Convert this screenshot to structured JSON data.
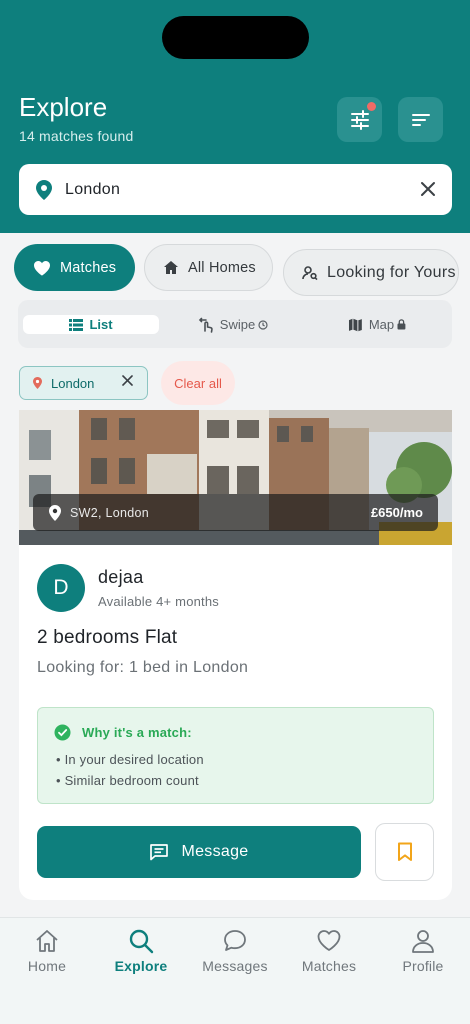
{
  "header": {
    "title": "Explore",
    "subtitle": "14 matches found",
    "filter_icon": "sliders-icon",
    "sort_icon": "sort-lines-icon",
    "accent": "#0e7f7d",
    "notification_dot": "#f06b66"
  },
  "search": {
    "value": "London",
    "icon": "location-pin-icon",
    "clear_icon": "close-icon"
  },
  "tabs": [
    {
      "label": "Matches",
      "icon": "heart-icon",
      "active": true
    },
    {
      "label": "All Homes",
      "icon": "home-icon",
      "active": false
    },
    {
      "label": "Looking for Yours",
      "icon": "person-search-icon",
      "active": false
    }
  ],
  "view_toggle": {
    "list": "List",
    "swipe": "Swipe",
    "map": "Map",
    "selected": "List"
  },
  "filters": {
    "chip_label": "London",
    "clear_all": "Clear all"
  },
  "listing": {
    "location": "SW2, London",
    "price": "£650/mo",
    "avatar_letter": "D",
    "user_name": "dejaa",
    "availability": "Available 4+ months",
    "title": "2 bedrooms Flat",
    "looking_for": "Looking for: 1 bed in London",
    "why_title": "Why it's a match:",
    "reasons": [
      "• In your desired location",
      "• Similar bedroom count"
    ],
    "message_label": "Message",
    "bookmark_color": "#f2a51a"
  },
  "bottom_nav": [
    {
      "label": "Home",
      "icon": "home-icon",
      "active": false
    },
    {
      "label": "Explore",
      "icon": "search-icon",
      "active": true
    },
    {
      "label": "Messages",
      "icon": "chat-bubble-icon",
      "active": false
    },
    {
      "label": "Matches",
      "icon": "heart-icon",
      "active": false
    },
    {
      "label": "Profile",
      "icon": "person-icon",
      "active": false
    }
  ]
}
